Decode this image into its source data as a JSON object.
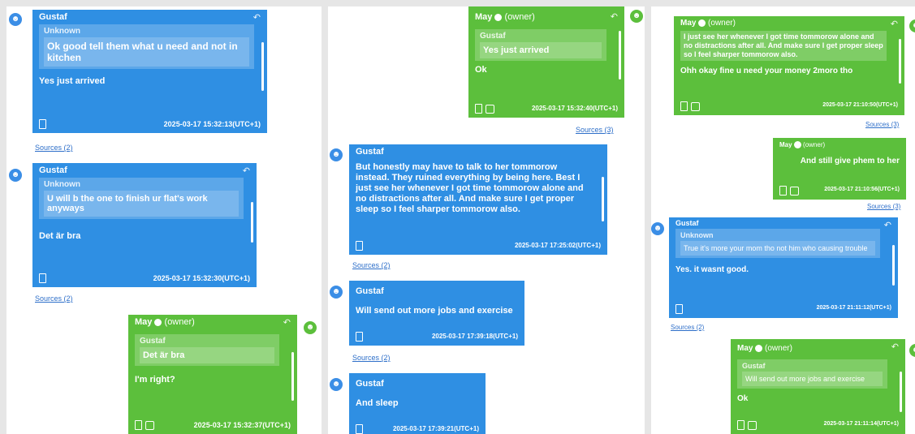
{
  "panel1": {
    "msg1": {
      "sender": "Gustaf",
      "quote_sender": "Unknown",
      "quote_text": "Ok good tell them what u need and not in kitchen",
      "text": "Yes just arrived",
      "timestamp": "2025-03-17 15:32:13(UTC+1)"
    },
    "sources1": "Sources (2)",
    "msg2": {
      "sender": "Gustaf",
      "quote_sender": "Unknown",
      "quote_text": "U will b the one to finish ur flat's work anyways",
      "text": "Det är bra",
      "timestamp": "2025-03-17 15:32:30(UTC+1)"
    },
    "sources2": "Sources (2)",
    "msg3": {
      "sender": "May",
      "owner": "(owner)",
      "quote_sender": "Gustaf",
      "quote_text": "Det är bra",
      "text": "I'm right?",
      "timestamp": "2025-03-17 15:32:37(UTC+1)"
    }
  },
  "panel2": {
    "msg1": {
      "sender": "May",
      "owner": "(owner)",
      "quote_sender": "Gustaf",
      "quote_text": "Yes just arrived",
      "text": "Ok",
      "timestamp": "2025-03-17 15:32:40(UTC+1)"
    },
    "sources1": "Sources (3)",
    "msg2": {
      "sender": "Gustaf",
      "text": "But honestly may have to talk to her tommorow instead. They ruined everything by being here. Best I just see her whenever I got time tommorow alone and no distractions after all. And make sure I get proper sleep so I feel sharper tommorow also.",
      "timestamp": "2025-03-17 17:25:02(UTC+1)"
    },
    "sources2": "Sources (2)",
    "msg3": {
      "sender": "Gustaf",
      "text": "Will send out more jobs and exercise",
      "timestamp": "2025-03-17 17:39:18(UTC+1)"
    },
    "sources3": "Sources (2)",
    "msg4": {
      "sender": "Gustaf",
      "text": "And sleep",
      "timestamp": "2025-03-17 17:39:21(UTC+1)"
    }
  },
  "panel3": {
    "msg1": {
      "sender": "May",
      "owner": "(owner)",
      "quote_text": "I just see her whenever I got time tommorow alone and no distractions after all. And make sure I get proper sleep so I feel sharper tommorow also.",
      "text": "Ohh okay fine u need your money 2moro tho",
      "timestamp": "2025-03-17 21:10:50(UTC+1)"
    },
    "sources1": "Sources (3)",
    "msg2": {
      "sender": "May",
      "owner": "(owner)",
      "text": "And still give phem to her",
      "timestamp": "2025-03-17 21:10:56(UTC+1)"
    },
    "sources2": "Sources (3)",
    "msg3": {
      "sender": "Gustaf",
      "quote_sender": "Unknown",
      "quote_text": "True it's more your mom tho not him who causing trouble",
      "text": "Yes. it wasnt good.",
      "timestamp": "2025-03-17 21:11:12(UTC+1)"
    },
    "sources3": "Sources (2)",
    "msg4": {
      "sender": "May",
      "owner": "(owner)",
      "quote_sender": "Gustaf",
      "quote_text": "Will send out more jobs and exercise",
      "text": "Ok",
      "timestamp": "2025-03-17 21:11:14(UTC+1)"
    }
  },
  "icons": {
    "reply": "reply-icon",
    "avatar": "person-icon",
    "phone": "phone-icon",
    "camera": "photo-icon"
  },
  "colors": {
    "blue": "#2f8fe3",
    "green": "#5cbf3c",
    "link": "#2e6fc9"
  }
}
